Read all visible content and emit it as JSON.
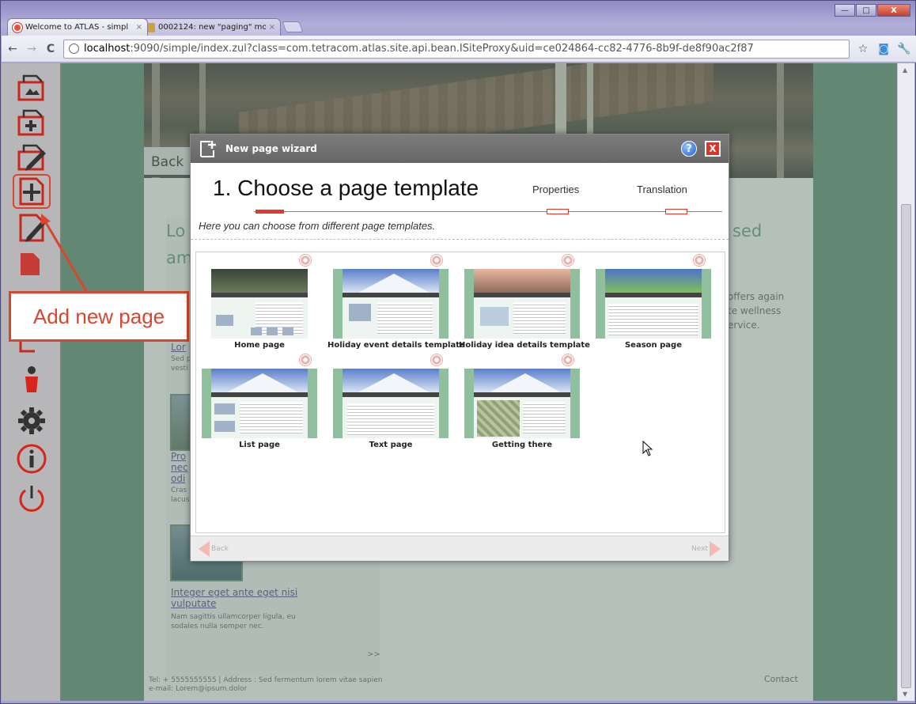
{
  "browser": {
    "tabs": [
      {
        "title": "Welcome to ATLAS - simpl",
        "close": "×",
        "active": true
      },
      {
        "title": "0002124: new \"paging\" moc",
        "close": "×",
        "active": false
      }
    ],
    "url_host": "localhost",
    "url_rest": ":9090/simple/index.zul?class=com.tetracom.atlas.site.api.bean.ISiteProxy&uid=ce024864-cc82-4776-8b9f-de8f90ac2f87",
    "nav": {
      "back": "←",
      "forward": "→",
      "reload": "C"
    },
    "toolbar_icons": [
      "star-icon",
      "extension-icon",
      "wrench-icon"
    ],
    "window_controls": {
      "minimize": "—",
      "maximize": "□",
      "close": "X"
    }
  },
  "sidebar": {
    "items": [
      {
        "name": "site-list-icon"
      },
      {
        "name": "add-site-icon"
      },
      {
        "name": "edit-site-icon"
      },
      {
        "name": "add-page-icon"
      },
      {
        "name": "edit-page-icon"
      },
      {
        "name": "copy-page-icon"
      },
      {
        "name": "move-page-icon"
      },
      {
        "name": "user-icon"
      },
      {
        "name": "settings-icon"
      },
      {
        "name": "info-icon"
      },
      {
        "name": "power-icon"
      }
    ]
  },
  "background_site": {
    "back_label": "Back",
    "heading_fragments": [
      "Lo",
      "am",
      "sed"
    ],
    "right_text": [
      "offers again",
      "te wellness",
      "ervice."
    ],
    "left_link_1": "Lor",
    "left_small_1": [
      "Sed p",
      "vesti"
    ],
    "left_link_2": [
      "Pro",
      "nec",
      "odi"
    ],
    "left_small_2": [
      "Cras",
      "lacus"
    ],
    "article_link": [
      "Integer eget ante eget nisi",
      "vulputate"
    ],
    "article_text": [
      "Nam sagittis ullamcorper ligula, eu",
      "sodales nulla semper nec."
    ],
    "pager": ">>",
    "footer_line1": "Tel: + 5555555555 | Address : Sed fermentum lorem vitae sapien",
    "footer_line2": "e-mail: Lorem@ipsum.dolor",
    "footer_contact": "Contact"
  },
  "annotation": {
    "label": "Add new page",
    "color": "#d8472d"
  },
  "dialog": {
    "title": "New page wizard",
    "help": "?",
    "close": "X",
    "step_current": "1. Choose a page template",
    "step_2": "Properties",
    "step_3": "Translation",
    "description": "Here you can choose from different page templates.",
    "templates": [
      {
        "name": "Home page"
      },
      {
        "name": "Holiday event details template"
      },
      {
        "name": "Holiday idea details template"
      },
      {
        "name": "Season page"
      },
      {
        "name": "List page"
      },
      {
        "name": "Text page"
      },
      {
        "name": "Getting there"
      }
    ],
    "back_button": "Back",
    "next_button": "Next",
    "accent_color": "#e23b2e"
  }
}
